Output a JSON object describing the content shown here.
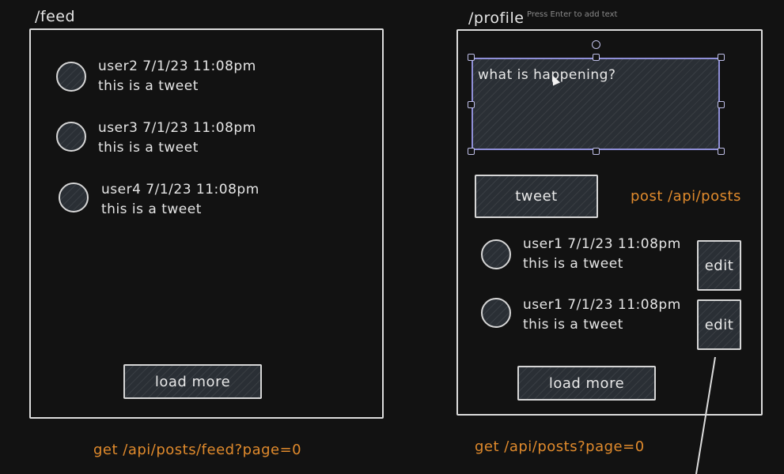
{
  "feed": {
    "title": "/feed",
    "tweets": [
      {
        "meta": "user2 7/1/23 11:08pm",
        "text": "this is a tweet"
      },
      {
        "meta": "user3 7/1/23 11:08pm",
        "text": "this is a tweet"
      },
      {
        "meta": "user4 7/1/23 11:08pm",
        "text": "this is a tweet"
      }
    ],
    "load_more": "load more",
    "api": "get /api/posts/feed?page=0"
  },
  "profile": {
    "title": "/profile",
    "hint": "Press Enter to add text",
    "textarea_text": "what is happening?",
    "tweet_button": "tweet",
    "post_api": "post /api/posts",
    "tweets": [
      {
        "meta": "user1 7/1/23 11:08pm",
        "text": "this is a tweet",
        "edit": "edit"
      },
      {
        "meta": "user1 7/1/23 11:08pm",
        "text": "this is a tweet",
        "edit": "edit"
      }
    ],
    "load_more": "load more",
    "api": "get /api/posts?page=0"
  },
  "colors": {
    "background": "#121212",
    "stroke": "#dcdcdc",
    "accent": "#e08a2c",
    "selection": "#8f8fd8"
  }
}
